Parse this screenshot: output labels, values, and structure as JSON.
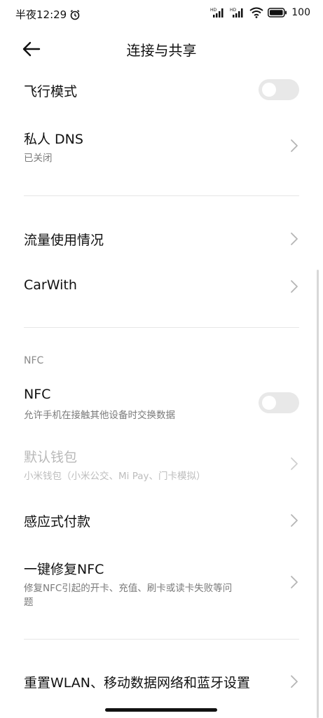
{
  "status_bar": {
    "time": "半夜12:29",
    "battery": "100",
    "icons": [
      "alarm-icon",
      "hd-signal-icon",
      "hd-signal-icon",
      "wifi-icon",
      "battery-icon"
    ]
  },
  "header": {
    "title": "连接与共享"
  },
  "rows": {
    "airplane": {
      "title": "飞行模式",
      "on": false
    },
    "private_dns": {
      "title": "私人 DNS",
      "subtitle": "已关闭"
    },
    "data_usage": {
      "title": "流量使用情况"
    },
    "carwith": {
      "title": "CarWith"
    },
    "nfc_header": "NFC",
    "nfc": {
      "title": "NFC",
      "subtitle": "允许手机在接触其他设备时交换数据",
      "on": false
    },
    "default_wallet": {
      "title": "默认钱包",
      "subtitle": "小米钱包（小米公交、Mi Pay、门卡模拟）"
    },
    "tap_pay": {
      "title": "感应式付款"
    },
    "fix_nfc": {
      "title": "一键修复NFC",
      "subtitle_line1": "修复NFC引起的开卡、充值、刷卡或读卡失败等问",
      "subtitle_line2": "题"
    },
    "reset": {
      "title": "重置WLAN、移动数据网络和蓝牙设置"
    }
  },
  "colors": {
    "text": "#111111",
    "subtext": "#7a7a7a",
    "disabled": "#b8b8b8",
    "toggle_off": "#e8e8e8",
    "divider": "#e6e6e6"
  }
}
